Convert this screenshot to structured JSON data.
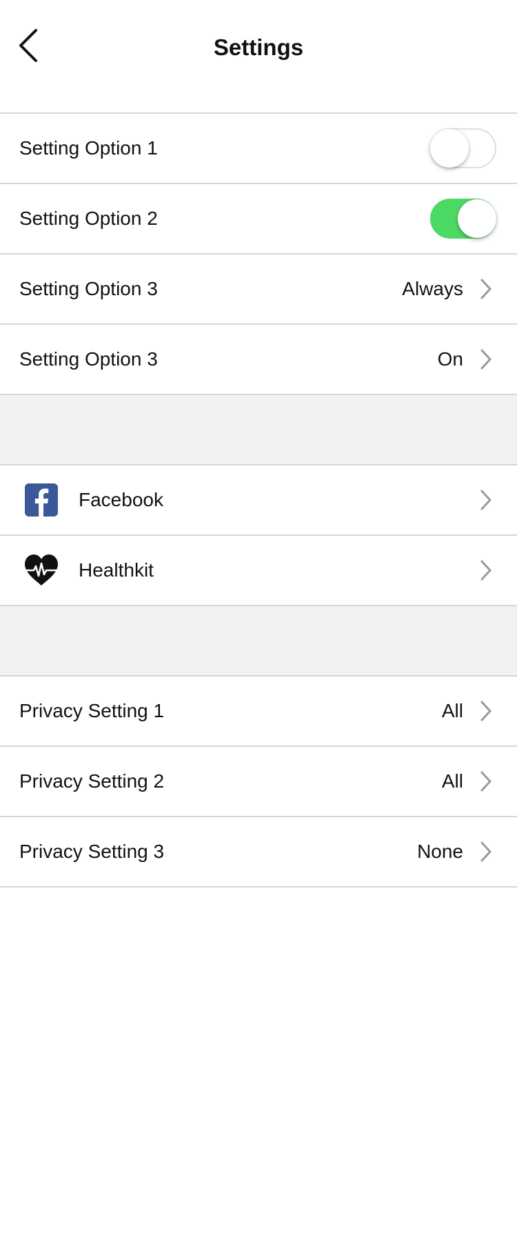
{
  "header": {
    "title": "Settings"
  },
  "settings": [
    {
      "label": "Setting Option 1",
      "type": "toggle",
      "on": false
    },
    {
      "label": "Setting Option 2",
      "type": "toggle",
      "on": true
    },
    {
      "label": "Setting Option 3",
      "type": "value",
      "value": "Always"
    },
    {
      "label": "Setting Option 3",
      "type": "value",
      "value": "On"
    }
  ],
  "integrations": [
    {
      "label": "Facebook",
      "icon": "facebook-icon"
    },
    {
      "label": "Healthkit",
      "icon": "heart-pulse-icon"
    }
  ],
  "privacy": [
    {
      "label": "Privacy Setting 1",
      "value": "All"
    },
    {
      "label": "Privacy Setting 2",
      "value": "All"
    },
    {
      "label": "Privacy Setting 3",
      "value": "None"
    }
  ],
  "colors": {
    "toggle_on": "#4cd964",
    "facebook": "#3b5998",
    "separator": "#d6d6d6",
    "section_gap": "#f2f2f2"
  }
}
